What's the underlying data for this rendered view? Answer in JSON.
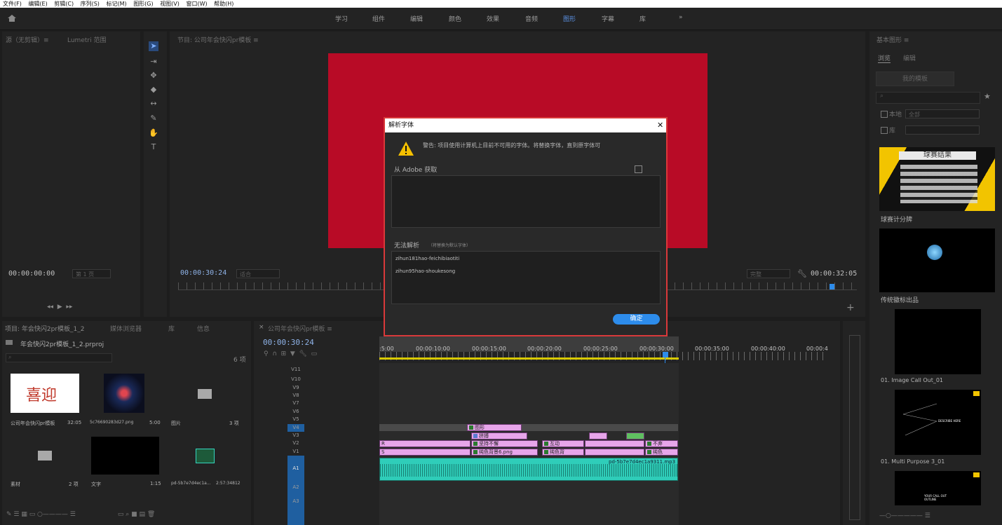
{
  "menubar": [
    "文件(F)",
    "编辑(E)",
    "剪辑(C)",
    "序列(S)",
    "标记(M)",
    "图形(G)",
    "视图(V)",
    "窗口(W)",
    "帮助(H)"
  ],
  "workspaces": [
    "学习",
    "组件",
    "编辑",
    "颜色",
    "效果",
    "音频",
    "图形",
    "字幕",
    "库"
  ],
  "workspace_more": "»",
  "source_panel": {
    "title": "源（无剪辑）≡",
    "tab2": "Lumetri 范围",
    "timecode": "00:00:00:00",
    "page": "第 1 页"
  },
  "program": {
    "title": "节目: 公司年会快闪pr模板 ≡",
    "timecode_left": "00:00:30:24",
    "fit": "适合",
    "quality": "完整",
    "timecode_right": "00:00:32:05"
  },
  "project": {
    "tab1": "项目: 年会快闪2pr模板_1_2",
    "tab2": "媒体浏览器",
    "tab3": "库",
    "tab4": "信息",
    "file": "年会快闪2pr模板_1_2.prproj",
    "count": "6 项",
    "items": [
      {
        "name": "公司年会快闪pr模板",
        "meta": "32:05",
        "thumb_text": "喜迎"
      },
      {
        "name": "5c76690283d27.png",
        "meta": "5:00"
      },
      {
        "name": "图片",
        "meta": "3 项"
      },
      {
        "name": "素材",
        "meta": "2 项"
      },
      {
        "name": "文字",
        "meta": "1:15"
      },
      {
        "name": "pd-5b7e7d4ec1a...",
        "meta": "2:57:34812"
      }
    ]
  },
  "timeline": {
    "title": "公司年会快闪pr模板 ≡",
    "timecode": "00:00:30:24",
    "ruler": [
      ":5:00",
      "00:00:10:00",
      "00:00:15:00",
      "00:00:20:00",
      "00:00:25:00",
      "00:00:30:00",
      "00:00:35:00",
      "00:00:40:00",
      "00:00:4"
    ],
    "video_tracks": [
      "V11",
      "V10",
      "V9",
      "V8",
      "V7",
      "V6",
      "V5",
      "V4",
      "V3",
      "V2",
      "V1"
    ],
    "audio_tracks": [
      "A1",
      "A2",
      "A3"
    ],
    "clips": {
      "graphic": "图形",
      "pinbo": "拼搏",
      "jianchi": "坚持不懈",
      "hudong": "互动",
      "buqi": "不弃",
      "chunse": "纯色背景6.png",
      "chunse2": "纯色背",
      "chunse3": "纯色",
      "audio": "pd-5b7e7d4ec1a9311.mp3",
      "r1": "R",
      "r2": "S"
    }
  },
  "essential_graphics": {
    "title": "基本图形 ≡",
    "tab_browse": "浏览",
    "tab_edit": "编辑",
    "my_templates": "我的模板",
    "local": "本地",
    "all": "全部",
    "lib": "库",
    "templates": [
      {
        "name": "球赛计分牌",
        "thumb_title": "球赛结果"
      },
      {
        "name": "传统徽标出品"
      },
      {
        "name": "01. Image Call Out_01"
      },
      {
        "name": "01. Multi Purpose 3_01",
        "thumb_text": "DESCRIBE HERE"
      },
      {
        "thumb_text": "YOUR CALL OUT OUTLINE"
      }
    ]
  },
  "dialog": {
    "title": "解析字体",
    "close": "✕",
    "warning": "警告: 项目使用计算机上目前不可用的字体。将替换字体，直到原字体可",
    "from_adobe": "从 Adobe 获取",
    "unresolved": "无法解析",
    "unresolved_note": "（将替换为默认字体）",
    "fonts": [
      "zihun181hao-feichibiaotiti",
      "zihun95hao-shoukesong"
    ],
    "ok": "确定"
  },
  "colors": {
    "accent": "#2d8ceb",
    "alert": "#d9393a",
    "program_red": "#b80b26",
    "clip": "#e7a5ea",
    "audio": "#35d6c0"
  }
}
